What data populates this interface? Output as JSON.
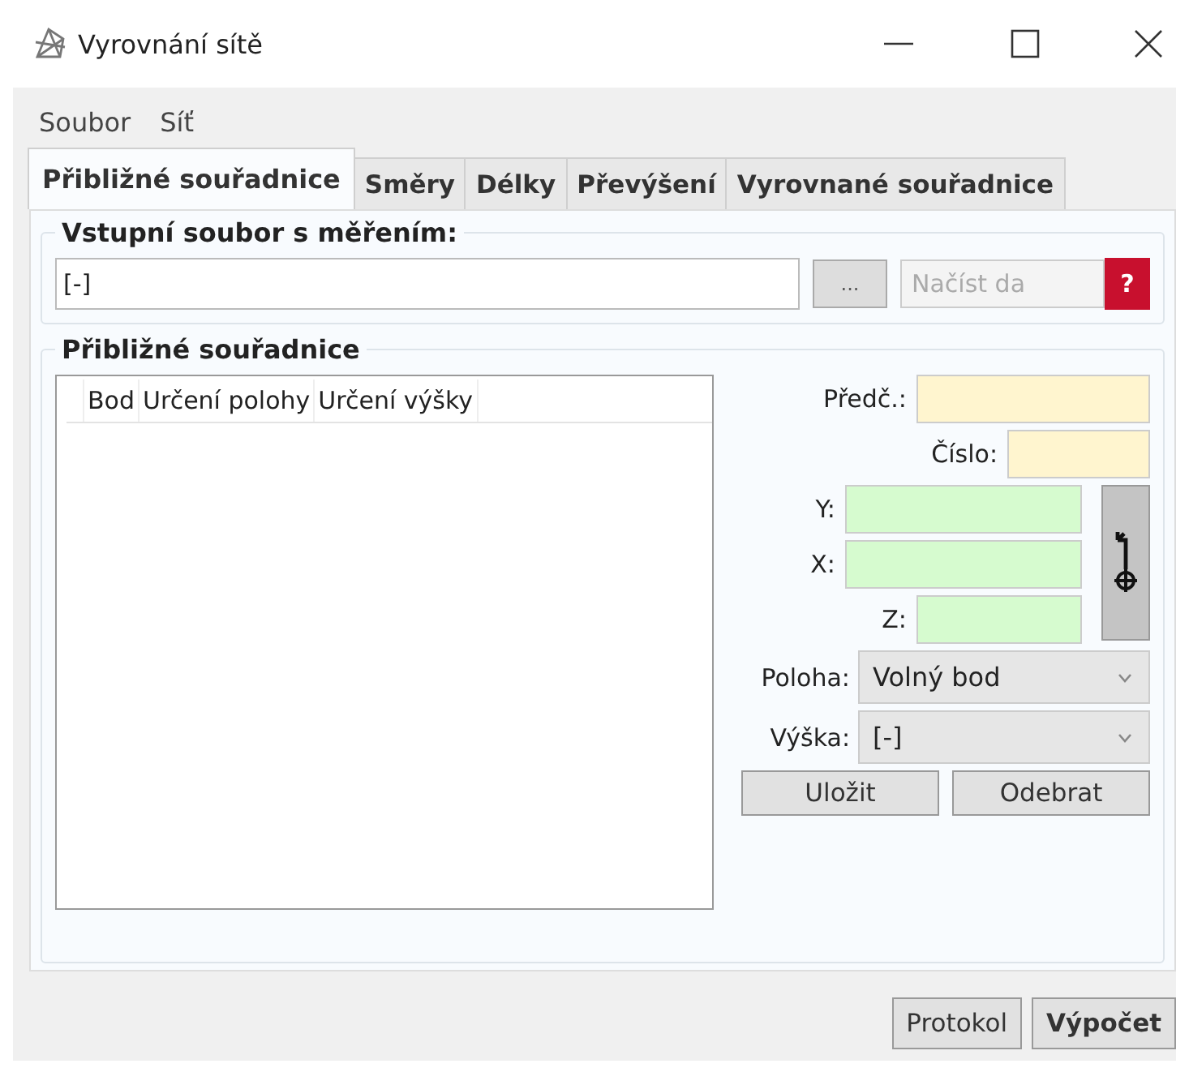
{
  "window": {
    "title": "Vyrovnání sítě"
  },
  "menu": [
    "Soubor",
    "Síť"
  ],
  "tabs": [
    {
      "label": "Přibližné souřadnice",
      "selected": true
    },
    {
      "label": "Směry",
      "selected": false
    },
    {
      "label": "Délky",
      "selected": false
    },
    {
      "label": "Převýšení",
      "selected": false
    },
    {
      "label": "Vyrovnané souřadnice",
      "selected": false
    }
  ],
  "input_group": {
    "title": "Vstupní soubor s měřením:",
    "file_value": "[-]",
    "browse_label": "...",
    "load_label": "Načíst da",
    "load_disabled": true,
    "help_label": "?"
  },
  "coords_group": {
    "title": "Přibližné souřadnice",
    "table": {
      "columns": [
        "Bod",
        "Určení polohy",
        "Určení výšky"
      ]
    },
    "fields": [
      {
        "label": "Předč.:",
        "kind": "prefix"
      },
      {
        "label": "Číslo:",
        "kind": "number"
      },
      {
        "label": "Y:",
        "kind": "coord"
      },
      {
        "label": "X:",
        "kind": "coord"
      },
      {
        "label": "Z:",
        "kind": "height"
      }
    ],
    "selects": [
      {
        "label": "Poloha:",
        "value": "Volný bod"
      },
      {
        "label": "Výška:",
        "value": "[-]"
      }
    ],
    "buttons": [
      "Uložit",
      "Odebrat"
    ]
  },
  "footer_buttons": [
    {
      "label": "Protokol",
      "primary": false
    },
    {
      "label": "Výpočet",
      "primary": true
    }
  ]
}
